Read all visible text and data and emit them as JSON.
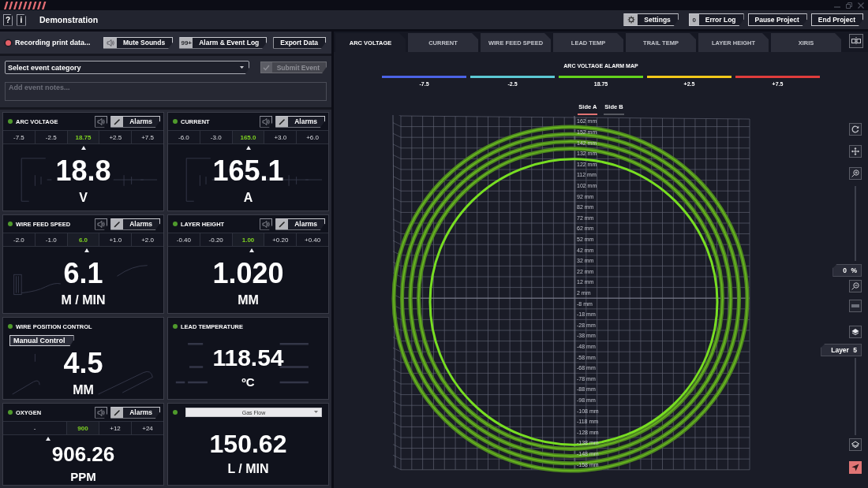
{
  "header": {
    "help": "?",
    "info": "i",
    "title": "Demonstration",
    "buttons": [
      {
        "kind": "settings",
        "label": "Settings"
      },
      {
        "kind": "count",
        "count": "0",
        "label": "Error Log"
      },
      {
        "kind": "plain",
        "label": "Pause Project"
      },
      {
        "kind": "plain",
        "label": "End Project"
      }
    ]
  },
  "recording": {
    "active": true,
    "label": "Recording print data..."
  },
  "toolbar": [
    {
      "kind": "sound",
      "label": "Mute Sounds"
    },
    {
      "kind": "badge",
      "badge": "99+",
      "label": "Alarm & Event Log"
    },
    {
      "kind": "plain",
      "label": "Export Data"
    }
  ],
  "event_form": {
    "category": {
      "value": "Select event category"
    },
    "submit": {
      "label": "Submit Event",
      "disabled": true
    },
    "notes": {
      "placeholder": "Add event notes..."
    }
  },
  "panels": [
    {
      "kind": "alarm",
      "title": "ARC VOLTAGE",
      "art": {
        "kind": "circuit"
      },
      "alarms_label": "Alarms",
      "thresholds": [
        {
          "label": "-7.5",
          "selected": false
        },
        {
          "label": "-2.5",
          "selected": false
        },
        {
          "label": "18.75",
          "selected": true
        },
        {
          "label": "+2.5",
          "selected": false
        },
        {
          "label": "+7.5",
          "selected": false
        }
      ],
      "level": 0.5,
      "value": "18.8",
      "unit": "V"
    },
    {
      "kind": "alarm",
      "title": "CURRENT",
      "art": {
        "kind": "circuit"
      },
      "alarms_label": "Alarms",
      "thresholds": [
        {
          "label": "-6.0",
          "selected": false
        },
        {
          "label": "-3.0",
          "selected": false
        },
        {
          "label": "165.0",
          "selected": true
        },
        {
          "label": "+3.0",
          "selected": false
        },
        {
          "label": "+6.0",
          "selected": false
        }
      ],
      "level": 0.5,
      "value": "165.1",
      "unit": "A"
    },
    {
      "kind": "alarm",
      "title": "WIRE FEED SPEED",
      "art": {
        "kind": "spool"
      },
      "alarms_label": "Alarms",
      "thresholds": [
        {
          "label": "-2.0",
          "selected": false
        },
        {
          "label": "-1.0",
          "selected": false
        },
        {
          "label": "6.0",
          "selected": true
        },
        {
          "label": "+1.0",
          "selected": false
        },
        {
          "label": "+2.0",
          "selected": false
        }
      ],
      "level": 0.52,
      "value": "6.1",
      "unit": "M / MIN"
    },
    {
      "kind": "alarm",
      "title": "LAYER HEIGHT",
      "alarms_label": "Alarms",
      "thresholds": [
        {
          "label": "-0.40",
          "selected": false
        },
        {
          "label": "-0.20",
          "selected": false
        },
        {
          "label": "1.00",
          "selected": true
        },
        {
          "label": "+0.20",
          "selected": false
        },
        {
          "label": "+0.40",
          "selected": false
        }
      ],
      "level": 0.52,
      "value": "1.020",
      "unit": "MM"
    },
    {
      "kind": "control",
      "title": "WIRE POSITION CONTROL",
      "art": {
        "kind": "wire"
      },
      "control_label": "Manual Control",
      "value": "4.5",
      "unit": "MM"
    },
    {
      "kind": "plain",
      "title": "LEAD TEMPERATURE",
      "art": {
        "kind": "gauge"
      },
      "value": "118.54",
      "unit": "ºC"
    },
    {
      "kind": "alarm",
      "title": "OXYGEN",
      "alarms_label": "Alarms",
      "thresholds": [
        {
          "label": "-",
          "selected": false,
          "wide": true
        },
        {
          "label": "900",
          "selected": true,
          "wide": false
        },
        {
          "label": "+12",
          "selected": false,
          "wide": false
        },
        {
          "label": "+24",
          "selected": false,
          "wide": false
        }
      ],
      "level": 0.28,
      "value": "906.26",
      "unit": "PPM"
    },
    {
      "kind": "select",
      "select": {
        "value": "Gas Flow"
      },
      "value": "150.62",
      "unit": "L / MIN"
    }
  ],
  "chart_tabs": [
    {
      "label": "ARC VOLTAGE",
      "selected": true
    },
    {
      "label": "CURRENT",
      "selected": false
    },
    {
      "label": "WIRE FEED SPEED",
      "selected": false
    },
    {
      "label": "LEAD TEMP",
      "selected": false
    },
    {
      "label": "TRAIL TEMP",
      "selected": false
    },
    {
      "label": "LAYER HEIGHT",
      "selected": false
    },
    {
      "label": "XIRIS",
      "selected": false
    }
  ],
  "alarm_map": {
    "title": "ARC VOLTAGE ALARM MAP",
    "ranges": [
      {
        "label": "-7.5",
        "color": "#4b63e6"
      },
      {
        "label": "-2.5",
        "color": "#5cc9d4"
      },
      {
        "label": "18.75",
        "color": "#63d31c"
      },
      {
        "label": "+2.5",
        "color": "#f2c81a"
      },
      {
        "label": "+7.5",
        "color": "#e03c3c"
      }
    ]
  },
  "side_tabs": [
    {
      "label": "Side A",
      "selected": true
    },
    {
      "label": "Side B",
      "selected": false
    }
  ],
  "viewer": {
    "axis_labels": [
      "162 mm",
      "152 mm",
      "142 mm",
      "132 mm",
      "122 mm",
      "112 mm",
      "102 mm",
      "92 mm",
      "82 mm",
      "72 mm",
      "62 mm",
      "52 mm",
      "42 mm",
      "32 mm",
      "22 mm",
      "12 mm",
      "2 mm",
      "-8 mm",
      "-18 mm",
      "-28 mm",
      "-38 mm",
      "-48 mm",
      "-58 mm",
      "-68 mm",
      "-78 mm",
      "-88 mm",
      "-98 mm",
      "-108 mm",
      "-118 mm",
      "-128 mm",
      "-138 mm",
      "-148 mm",
      "-158 mm"
    ],
    "zoom_reading": "0 %",
    "layer_reading": "Layer 5"
  }
}
